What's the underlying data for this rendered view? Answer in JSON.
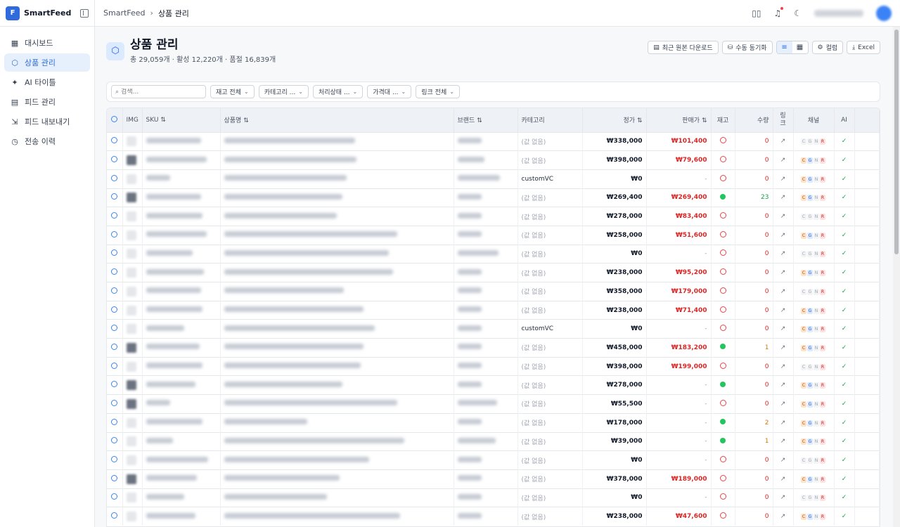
{
  "brand": {
    "logo_letter": "F",
    "name": "SmartFeed"
  },
  "nav": [
    {
      "label": "대시보드",
      "icon": "dashboard-icon",
      "glyph": "▦",
      "active": false
    },
    {
      "label": "상품 관리",
      "icon": "box-icon",
      "glyph": "⬡",
      "active": true
    },
    {
      "label": "AI 타이틀",
      "icon": "sparkle-icon",
      "glyph": "✦",
      "active": false
    },
    {
      "label": "피드 관리",
      "icon": "document-icon",
      "glyph": "▤",
      "active": false
    },
    {
      "label": "피드 내보내기",
      "icon": "export-icon",
      "glyph": "⇲",
      "active": false
    },
    {
      "label": "전송 이력",
      "icon": "clock-icon",
      "glyph": "◷",
      "active": false
    }
  ],
  "header": {
    "crumb_root": "SmartFeed",
    "crumb_sep": "›",
    "crumb_current": "상품 관리"
  },
  "page": {
    "title": "상품 관리",
    "subtitle": "총 29,059개 · 활성 12,220개 · 품절 16,839개"
  },
  "actions": {
    "download": "최근 원본 다운로드",
    "sync": "수동 동기화",
    "columns": "컬럼",
    "excel": "Excel"
  },
  "filters": {
    "search_placeholder": "검색...",
    "stock": "재고 전체",
    "category": "카테고리 ...",
    "status": "처리상태 ...",
    "price": "가격대 ...",
    "link": "링크 전체"
  },
  "table": {
    "headers": {
      "img": "IMG",
      "sku": "SKU ⇅",
      "name": "상품명 ⇅",
      "brand": "브랜드 ⇅",
      "category": "카테고리",
      "price": "정가 ⇅",
      "sale": "판매가 ⇅",
      "stock": "재고",
      "qty": "수량",
      "link": "링\n크",
      "channel": "채널",
      "ai": "AI"
    },
    "rows": [
      {
        "cat": "(값 없음)",
        "price": "₩338,000",
        "sale": "₩101,400",
        "stock": false,
        "qty": "0",
        "ch": [
          0,
          0,
          0,
          1
        ],
        "thumb": 0
      },
      {
        "cat": "(값 없음)",
        "price": "₩398,000",
        "sale": "₩79,600",
        "stock": false,
        "qty": "0",
        "ch": [
          1,
          1,
          0,
          1
        ],
        "thumb": 1
      },
      {
        "cat": "customVC",
        "price": "₩0",
        "sale": "-",
        "stock": false,
        "qty": "0",
        "ch": [
          1,
          1,
          0,
          1
        ],
        "thumb": 0
      },
      {
        "cat": "(값 없음)",
        "price": "₩269,400",
        "sale": "₩269,400",
        "stock": true,
        "qty": "23",
        "ch": [
          1,
          1,
          0,
          1
        ],
        "thumb": 1
      },
      {
        "cat": "(값 없음)",
        "price": "₩278,000",
        "sale": "₩83,400",
        "stock": false,
        "qty": "0",
        "ch": [
          0,
          0,
          0,
          1
        ],
        "thumb": 0
      },
      {
        "cat": "(값 없음)",
        "price": "₩258,000",
        "sale": "₩51,600",
        "stock": false,
        "qty": "0",
        "ch": [
          1,
          1,
          0,
          1
        ],
        "thumb": 0
      },
      {
        "cat": "(값 없음)",
        "price": "₩0",
        "sale": "-",
        "stock": false,
        "qty": "0",
        "ch": [
          0,
          0,
          0,
          1
        ],
        "thumb": 0
      },
      {
        "cat": "(값 없음)",
        "price": "₩238,000",
        "sale": "₩95,200",
        "stock": false,
        "qty": "0",
        "ch": [
          1,
          1,
          0,
          1
        ],
        "thumb": 0
      },
      {
        "cat": "(값 없음)",
        "price": "₩358,000",
        "sale": "₩179,000",
        "stock": false,
        "qty": "0",
        "ch": [
          0,
          0,
          0,
          1
        ],
        "thumb": 0
      },
      {
        "cat": "(값 없음)",
        "price": "₩238,000",
        "sale": "₩71,400",
        "stock": false,
        "qty": "0",
        "ch": [
          1,
          1,
          0,
          1
        ],
        "thumb": 0
      },
      {
        "cat": "customVC",
        "price": "₩0",
        "sale": "-",
        "stock": false,
        "qty": "0",
        "ch": [
          1,
          1,
          0,
          1
        ],
        "thumb": 0
      },
      {
        "cat": "(값 없음)",
        "price": "₩458,000",
        "sale": "₩183,200",
        "stock": true,
        "qty": "1",
        "ch": [
          1,
          1,
          0,
          1
        ],
        "thumb": 1
      },
      {
        "cat": "(값 없음)",
        "price": "₩398,000",
        "sale": "₩199,000",
        "stock": false,
        "qty": "0",
        "ch": [
          0,
          0,
          0,
          1
        ],
        "thumb": 0
      },
      {
        "cat": "(값 없음)",
        "price": "₩278,000",
        "sale": "-",
        "stock": true,
        "qty": "0",
        "ch": [
          1,
          1,
          0,
          1
        ],
        "thumb": 1
      },
      {
        "cat": "(값 없음)",
        "price": "₩55,500",
        "sale": "-",
        "stock": false,
        "qty": "0",
        "ch": [
          1,
          1,
          0,
          1
        ],
        "thumb": 1
      },
      {
        "cat": "(값 없음)",
        "price": "₩178,000",
        "sale": "-",
        "stock": true,
        "qty": "2",
        "ch": [
          1,
          1,
          0,
          1
        ],
        "thumb": 0
      },
      {
        "cat": "(값 없음)",
        "price": "₩39,000",
        "sale": "-",
        "stock": true,
        "qty": "1",
        "ch": [
          1,
          1,
          0,
          1
        ],
        "thumb": 0
      },
      {
        "cat": "(값 없음)",
        "price": "₩0",
        "sale": "-",
        "stock": false,
        "qty": "0",
        "ch": [
          0,
          0,
          0,
          1
        ],
        "thumb": 0
      },
      {
        "cat": "(값 없음)",
        "price": "₩378,000",
        "sale": "₩189,000",
        "stock": false,
        "qty": "0",
        "ch": [
          1,
          1,
          0,
          1
        ],
        "thumb": 1
      },
      {
        "cat": "(값 없음)",
        "price": "₩0",
        "sale": "-",
        "stock": false,
        "qty": "0",
        "ch": [
          0,
          0,
          0,
          1
        ],
        "thumb": 0
      },
      {
        "cat": "(값 없음)",
        "price": "₩238,000",
        "sale": "₩47,600",
        "stock": false,
        "qty": "0",
        "ch": [
          1,
          1,
          0,
          1
        ],
        "thumb": 0
      }
    ],
    "channel_letters": [
      "C",
      "G",
      "N",
      "R"
    ],
    "ai_mark": "✓",
    "link_mark": "↗"
  }
}
